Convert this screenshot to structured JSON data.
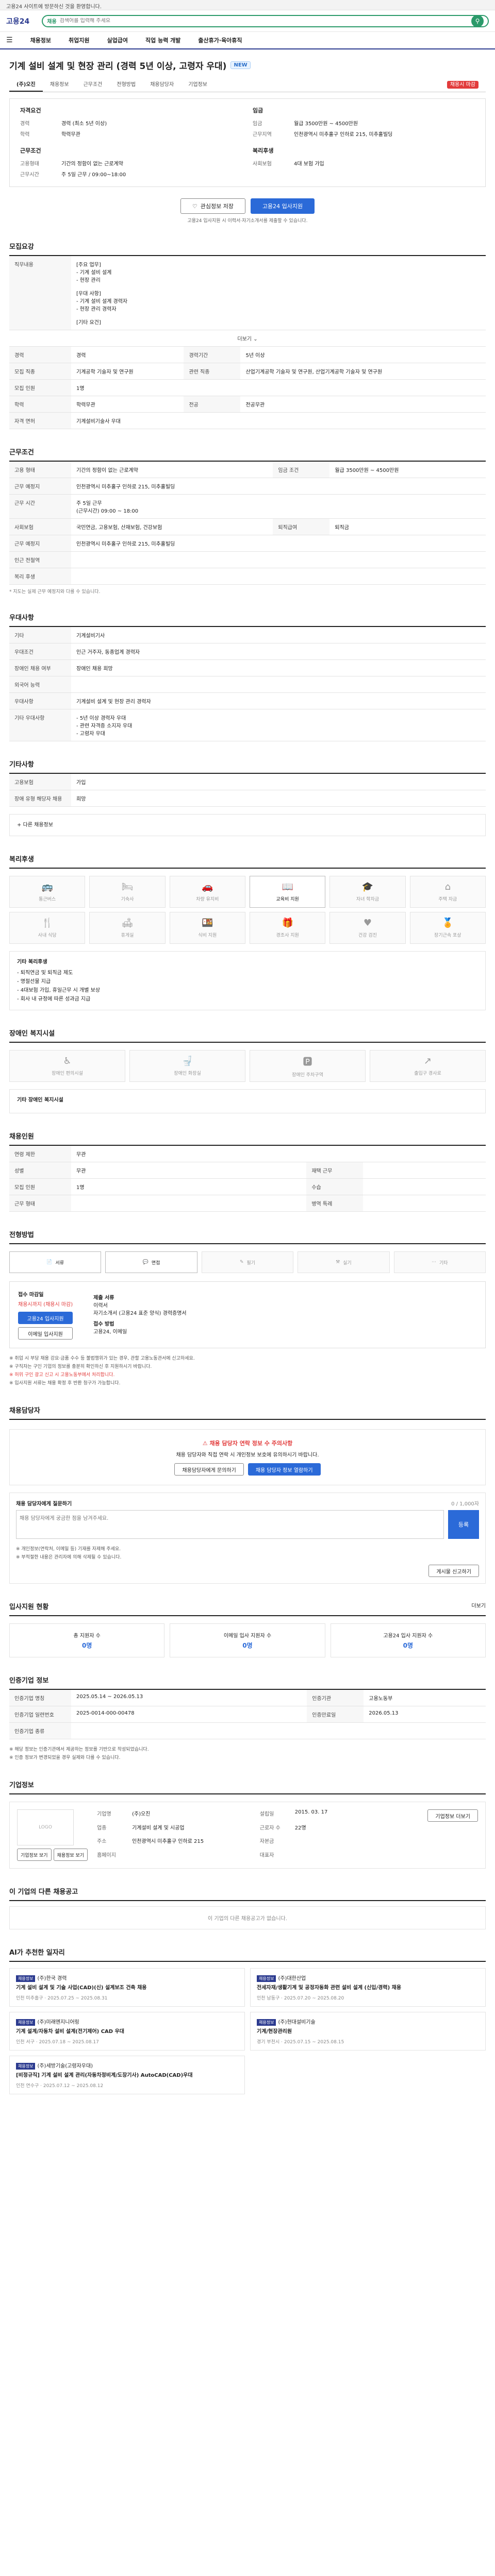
{
  "top": {
    "notice": "고용24 사이트에 방문하신 것을 환영합니다.",
    "logo": "고용24",
    "logo_sub": "",
    "search_value": "",
    "search_placeholder": "검색어를 입력해 주세요",
    "search_tag": "채용"
  },
  "gnb": [
    "채용정보",
    "취업지원",
    "실업급여",
    "직업 능력 개발",
    "출산휴가·육아휴직"
  ],
  "posting": {
    "title": "기계 설비 설계 및 현장 관리 (경력 5년 이상, 고령자 우대)",
    "badge": "NEW",
    "company": "(주)오진",
    "tabs": [
      "채용정보",
      "근무조건",
      "전형방법",
      "채용담당자",
      "기업정보"
    ],
    "deadline_badge": "채용시 마감"
  },
  "summary": {
    "left_head": "자격요건",
    "left_rows": [
      {
        "k": "경력",
        "v": "경력 (최소 5년 이상)"
      },
      {
        "k": "학력",
        "v": "학력무관"
      }
    ],
    "left_head2": "근무조건",
    "left_rows2": [
      {
        "k": "고용형태",
        "v": "기간의 정함이 없는 근로계약"
      },
      {
        "k": "근무시간",
        "v": "주 5일 근무 / 09:00~18:00"
      }
    ],
    "right_head": "임금",
    "right_rows": [
      {
        "k": "임금",
        "v": "월급 3500만원 ~ 4500만원"
      },
      {
        "k": "근무지역",
        "v": "인천광역시 미추홀구 인하로 215, 미추홀빌딩"
      }
    ],
    "right_head2": "복리후생",
    "right_rows2": [
      {
        "k": "사회보험",
        "v": "4대 보험 가입"
      }
    ]
  },
  "actions": {
    "scrap": "관심정보 저장",
    "apply": "고용24 입사지원",
    "hint": "고용24 입사지원 시 이력서·자기소개서를 제출할 수 있습니다."
  },
  "sections": {
    "recruit": "모집요강",
    "work": "근무조건",
    "welfare_text": "우대사항",
    "detail": "기타사항",
    "welfare": "복리후생",
    "disabled": "장애인 복지시설",
    "worker": "채용인원",
    "method": "전형방법",
    "manager": "채용담당자",
    "stats": "입사지원 현황",
    "info": "인증기업 정보",
    "company": "기업정보",
    "other": "이 기업의 다른 채용공고",
    "recommend": "AI가 추천한 일자리"
  },
  "recruit": {
    "job_label": "직무내용",
    "job_value": "[주요 업무]\n- 기계 설비 설계\n- 현장 관리\n\n[우대 사항]\n- 기계 설비 설계 경력자\n- 현장 관리 경력자\n\n[기타 요건]",
    "more": "더보기",
    "rows": [
      {
        "k": "경력",
        "v": "경력",
        "k2": "경력기간",
        "v2": "5년 이상"
      },
      {
        "k": "모집 직종",
        "v": "기계공학 기술자 및 연구원",
        "k2": "관련 직종",
        "v2": "산업기계공학 기술자 및 연구원, 산업기계공학 기술자 및 연구원"
      },
      {
        "k": "모집 인원",
        "v": "1명",
        "k2": "",
        "v2": ""
      },
      {
        "k": "학력",
        "v": "학력무관",
        "k2": "전공",
        "v2": "전공무관"
      },
      {
        "k": "자격 면허",
        "v": "기계설비기술사 우대",
        "k2": "",
        "v2": ""
      }
    ]
  },
  "work": {
    "rows": [
      {
        "k": "고용 형태",
        "v": "기간의 정함이 없는 근로계약",
        "k2": "임금 조건",
        "v2": "월급 3500만원 ~ 4500만원"
      },
      {
        "k": "근무 예정지",
        "v": "인천광역시 미추홀구 인하로 215, 미추홀빌딩",
        "k2": "",
        "v2": ""
      },
      {
        "k": "근무 시간",
        "v": "주 5일 근무\n(근무시간) 09:00 ~ 18:00",
        "k2": "",
        "v2": ""
      },
      {
        "k": "사회보험",
        "v": "국민연금, 고용보험, 산재보험, 건강보험",
        "k2": "퇴직급여",
        "v2": "퇴직금"
      },
      {
        "k": "근무 예정지",
        "v": "인천광역시 미추홀구 인하로 215, 미추홀빌딩",
        "k2": "",
        "v2": ""
      },
      {
        "k": "인근 전철역",
        "v": "",
        "k2": "",
        "v2": ""
      },
      {
        "k": "복리 후생",
        "v": "",
        "k2": "",
        "v2": ""
      }
    ],
    "note": "* 지도는 실제 근무 예정지와 다를 수 있습니다."
  },
  "prefer": {
    "rows": [
      {
        "k": "기타",
        "v": "기계설비기사"
      },
      {
        "k": "우대조건",
        "v": "인근 거주자, 동종업계 경력자"
      },
      {
        "k": "장애인 채용 여부",
        "v": "장애인 채용 희망"
      },
      {
        "k": "외국어 능력",
        "v": ""
      },
      {
        "k": "우대사항",
        "v": "기계설비 설계 및 현장 관리 경력자"
      },
      {
        "k": "기타 우대사항",
        "v": "- 5년 이상 경력자 우대\n- 관련 자격증 소지자 우대\n- 고령자 우대"
      }
    ]
  },
  "detail": {
    "rows": [
      {
        "k": "고용보험",
        "v": "가입"
      },
      {
        "k": "장애 유형 해당자 채용",
        "v": "희망"
      }
    ],
    "more": "다른 채용정보"
  },
  "welfare": {
    "items": [
      {
        "label": "통근버스",
        "icon": "bus-icon",
        "on": false
      },
      {
        "label": "기숙사",
        "icon": "bed-icon",
        "on": false
      },
      {
        "label": "차량 유지비",
        "icon": "car-icon",
        "on": false
      },
      {
        "label": "교육비 지원",
        "icon": "book-icon",
        "on": true
      },
      {
        "label": "자녀 학자금",
        "icon": "graduation-icon",
        "on": false
      },
      {
        "label": "주택 자금",
        "icon": "house-icon",
        "on": false
      },
      {
        "label": "사내 식당",
        "icon": "fork-icon",
        "on": false
      },
      {
        "label": "휴게실",
        "icon": "sofa-icon",
        "on": false
      },
      {
        "label": "식비 지원",
        "icon": "meal-icon",
        "on": false
      },
      {
        "label": "경조사 지원",
        "icon": "gift-icon",
        "on": false
      },
      {
        "label": "건강 검진",
        "icon": "heart-icon",
        "on": false
      },
      {
        "label": "장기근속 포상",
        "icon": "medal-icon",
        "on": false
      }
    ],
    "note_title": "기타 복리후생",
    "note_lines": [
      "- 퇴직연금 및 퇴직금 제도",
      "- 명절선물 지급",
      "- 4대보험 가입, 휴일근무 시 개별 보상",
      "- 회사 내 규정에 따른 성과금 지급"
    ]
  },
  "disabled": {
    "items": [
      {
        "label": "장애인 편의시설",
        "icon": "wheelchair-icon"
      },
      {
        "label": "장애인 화장실",
        "icon": "toilet-icon"
      },
      {
        "label": "장애인 주차구역",
        "icon": "parking-icon"
      },
      {
        "label": "출입구 경사로",
        "icon": "ramp-icon"
      }
    ],
    "note": "기타 장애인 복지시설"
  },
  "worker": {
    "rows": [
      {
        "k": "연령 제한",
        "v": "무관",
        "k2": "",
        "v2": ""
      },
      {
        "k": "성별",
        "v": "무관",
        "k2": "재택 근무",
        "v2": ""
      },
      {
        "k": "모집 인원",
        "v": "1명",
        "k2": "수습",
        "v2": ""
      },
      {
        "k": "근무 형태",
        "v": "",
        "k2": "병역 특례",
        "v2": ""
      }
    ]
  },
  "method": {
    "items": [
      {
        "label": "서류",
        "icon": "document-icon"
      },
      {
        "label": "면접",
        "icon": "interview-icon"
      },
      {
        "label": "필기",
        "icon": "pencil-icon"
      },
      {
        "label": "실기",
        "icon": "tool-icon"
      },
      {
        "label": "기타",
        "icon": "more-icon"
      }
    ],
    "apply_title": "접수 마감일",
    "dday": "채용시까지 (채용시 마감)",
    "apply_button": "고용24 입사지원",
    "email_button": "이메일 입사지원",
    "docs_title": "제출 서류",
    "docs": "이력서\n자기소개서 (고용24 표준 양식) 경력증명서",
    "method_title": "접수 방법",
    "method_value": "고용24, 이메일",
    "notes": [
      "※ 취업 시 부당 채용 강요·금품 수수 등 불법행위가 있는 경우, 관할 고용노동관서에 신고하세요.",
      "※ 구직자는 구인 기업의 정보를 충분히 확인하신 후 지원하시기 바랍니다.",
      "※ 허위 구인 광고 신고 시 고용노동부에서 처리합니다.",
      "※ 입사지원 서류는 채용 확정 후 반환 청구가 가능합니다."
    ]
  },
  "manager": {
    "warn": "채용 담당자 연락 정보 수 주의사항",
    "desc": "채용 담당자와 직접 연락 시 개인정보 보호에 유의하시기 바랍니다.",
    "btn1": "채용담당자에게 문의하기",
    "btn2": "채용 담당자 정보 열람하기",
    "inquiry_title": "채용 담당자에게 질문하기",
    "inquiry_right": "0 / 1,000자",
    "inquiry_placeholder": "채용 담당자에게 궁금한 점을 남겨주세요.",
    "inquiry_submit": "등록",
    "inquiry_notes": [
      "※ 개인정보(연락처, 이메일 등) 기재를 자제해 주세요.",
      "※ 부적절한 내용은 관리자에 의해 삭제될 수 있습니다."
    ],
    "report": "게시물 신고하기"
  },
  "stats": {
    "more": "더보기",
    "cards": [
      {
        "label": "총 지원자 수",
        "num": "0명"
      },
      {
        "label": "이메일 입사 지원자 수",
        "num": "0명"
      },
      {
        "label": "고용24 입사 지원자 수",
        "num": "0명"
      }
    ]
  },
  "info": {
    "rows": [
      {
        "k": "인증기업 명칭",
        "v": "2025.05.14 ~ 2026.05.13",
        "k2": "인증기관",
        "v2": "고용노동부"
      },
      {
        "k": "인증기업 일련번호",
        "v": "2025-0014-000-00478",
        "k2": "인증만료일",
        "v2": "2026.05.13"
      },
      {
        "k": "인증기업 종류",
        "v": "",
        "k2": "",
        "v2": ""
      }
    ],
    "notes": [
      "※ 해당 정보는 인증기관에서 제공하는 정보를 기반으로 작성되었습니다.",
      "※ 인증 정보가 변경되었을 경우 실제와 다를 수 있습니다."
    ]
  },
  "company": {
    "logo": "LOGO",
    "more": "기업정보 더보기",
    "grid": [
      {
        "k": "기업명",
        "v": "(주)오진"
      },
      {
        "k": "설립일",
        "v": "2015. 03. 17"
      },
      {
        "k": "업종",
        "v": "기계설비 설계 및 시공업"
      },
      {
        "k": "근로자 수",
        "v": "22명"
      },
      {
        "k": "주소",
        "v": "인천광역시 미추홀구 인하로 215"
      },
      {
        "k": "자본금",
        "v": ""
      },
      {
        "k": "홈페이지",
        "v": ""
      },
      {
        "k": "대표자",
        "v": ""
      }
    ],
    "btn1": "기업정보 보기",
    "btn2": "채용정보 보기"
  },
  "other": {
    "empty": "이 기업의 다른 채용공고가 없습니다."
  },
  "recommend": {
    "cards": [
      {
        "tag": "채용정보",
        "org": "(주)한국 경력",
        "title": "기계 설비 설계 및 기술 사업(CAD)(신) 설계보조 건축 채용",
        "meta": "인천 미추홀구 · 2025.07.25 ~ 2025.08.31"
      },
      {
        "tag": "채용정보",
        "org": "(주)대한산업",
        "title": "전세자재/생활기계 및 공정자동화 관련 설비 설계 (신입/경력) 채용",
        "meta": "인천 남동구 · 2025.07.20 ~ 2025.08.20"
      },
      {
        "tag": "채용정보",
        "org": "(주)미래엔지니어링",
        "title": "기계 설계/자동차 설비 설계(전기제어) CAD 우대",
        "meta": "인천 서구 · 2025.07.18 ~ 2025.08.17"
      },
      {
        "tag": "채용정보",
        "org": "(주)현대설비기술",
        "title": "기계/현장관리원",
        "meta": "경기 부천시 · 2025.07.15 ~ 2025.08.15"
      },
      {
        "tag": "채용정보",
        "org": "(주)세방기술(고령자우대)",
        "title": "[비정규직] 기계 설비 설계 관리(자동차정비계/도장기사) AutoCAD(CAD)우대",
        "meta": "인천 연수구 · 2025.07.12 ~ 2025.08.12"
      }
    ]
  }
}
